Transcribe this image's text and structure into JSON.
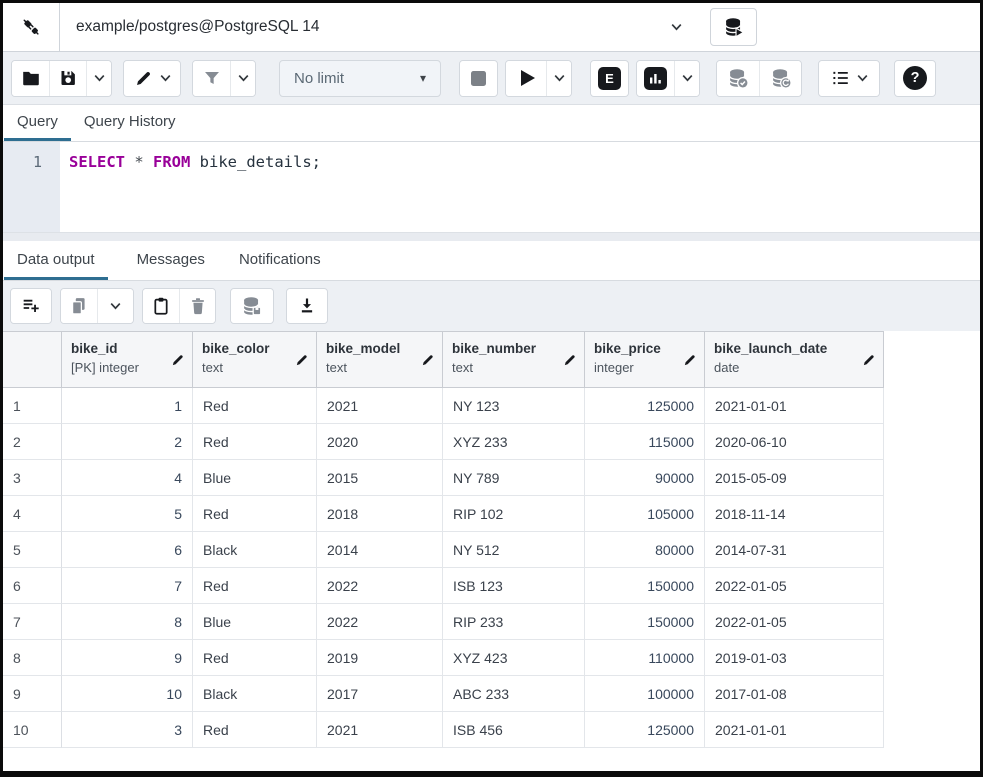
{
  "connection_bar": {
    "connection": "example/postgres@PostgreSQL 14"
  },
  "toolbar": {
    "limit": "No limit",
    "button_names": [
      "open-file",
      "save",
      "save-options",
      "edit-menu",
      "filter",
      "filter-options",
      "row-limit",
      "stop",
      "execute",
      "execute-options",
      "explain",
      "explain-analyze",
      "explain-options",
      "commit",
      "rollback",
      "macros",
      "help"
    ]
  },
  "icons": {
    "dropdown-triangle-icon": "▾",
    "explain-icon": "E",
    "help-icon": "?"
  },
  "query_tabs": {
    "items": [
      {
        "label": "Query",
        "active": true
      },
      {
        "label": "Query History",
        "active": false
      }
    ]
  },
  "editor": {
    "line_number": "1",
    "sql_text": "SELECT * FROM bike_details;",
    "tokens": [
      {
        "type": "keyword",
        "text": "SELECT "
      },
      {
        "type": "operator",
        "text": "* "
      },
      {
        "type": "keyword",
        "text": "FROM "
      },
      {
        "type": "plain",
        "text": "bike_details;"
      }
    ]
  },
  "output_tabs": {
    "items": [
      {
        "label": "Data output",
        "active": true
      },
      {
        "label": "Messages",
        "active": false
      },
      {
        "label": "Notifications",
        "active": false
      }
    ]
  },
  "result_toolbar": {
    "button_names": [
      "add-row",
      "copy",
      "copy-options",
      "paste",
      "delete",
      "save-data-changes",
      "download-csv"
    ]
  },
  "table": {
    "columns": [
      {
        "name": "bike_id",
        "type": "[PK] integer",
        "align": "right"
      },
      {
        "name": "bike_color",
        "type": "text",
        "align": "left"
      },
      {
        "name": "bike_model",
        "type": "text",
        "align": "left"
      },
      {
        "name": "bike_number",
        "type": "text",
        "align": "left"
      },
      {
        "name": "bike_price",
        "type": "integer",
        "align": "right"
      },
      {
        "name": "bike_launch_date",
        "type": "date",
        "align": "left"
      }
    ],
    "row_numbers": [
      "1",
      "2",
      "3",
      "4",
      "5",
      "6",
      "7",
      "8",
      "9",
      "10"
    ],
    "rows": [
      [
        "1",
        "Red",
        "2021",
        "NY 123",
        "125000",
        "2021-01-01"
      ],
      [
        "2",
        "Red",
        "2020",
        "XYZ 233",
        "115000",
        "2020-06-10"
      ],
      [
        "4",
        "Blue",
        "2015",
        "NY 789",
        "90000",
        "2015-05-09"
      ],
      [
        "5",
        "Red",
        "2018",
        "RIP 102",
        "105000",
        "2018-11-14"
      ],
      [
        "6",
        "Black",
        "2014",
        "NY 512",
        "80000",
        "2014-07-31"
      ],
      [
        "7",
        "Red",
        "2022",
        "ISB 123",
        "150000",
        "2022-01-05"
      ],
      [
        "8",
        "Blue",
        "2022",
        "RIP 233",
        "150000",
        "2022-01-05"
      ],
      [
        "9",
        "Red",
        "2019",
        "XYZ 423",
        "110000",
        "2019-01-03"
      ],
      [
        "10",
        "Black",
        "2017",
        "ABC 233",
        "100000",
        "2017-01-08"
      ],
      [
        "3",
        "Red",
        "2021",
        "ISB 456",
        "125000",
        "2021-01-01"
      ]
    ]
  },
  "colors": {
    "accent_tab": "#2e6e91",
    "keyword": "#990099",
    "toolbar_bg": "#edf0f4",
    "gutter_bg": "#e7ebf2",
    "grid_header_bg": "#f5f6f8",
    "icon_dark": "#17191d",
    "icon_gray": "#868c94"
  }
}
